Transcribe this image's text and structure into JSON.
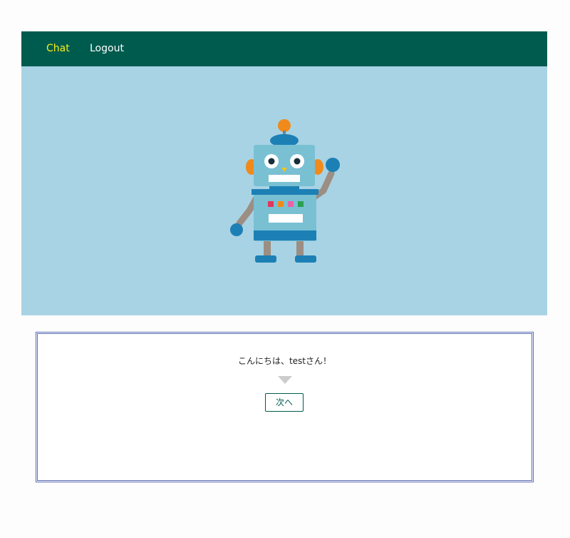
{
  "nav": {
    "items": [
      {
        "label": "Chat",
        "color": "#f5f018",
        "active": true
      },
      {
        "label": "Logout",
        "color": "#ffffff",
        "active": false
      }
    ],
    "background": "#005b4f"
  },
  "hero": {
    "background": "#a8d3e4",
    "illustration": "robot-illustration"
  },
  "dialog": {
    "message": "こんにちは、testさん！",
    "indicator_icon": "down-triangle-icon",
    "next_label": "次へ",
    "border_color": "#5b6bb4"
  }
}
